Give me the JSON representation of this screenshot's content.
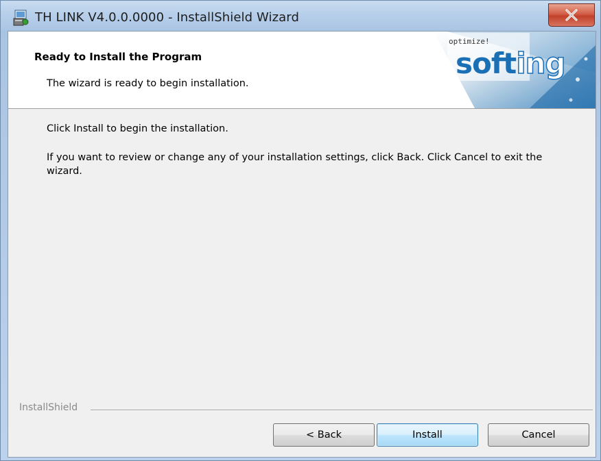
{
  "window": {
    "title": "TH LINK V4.0.0.0000 - InstallShield Wizard",
    "icon": "installer-icon",
    "close_icon": "close-icon"
  },
  "header": {
    "title": "Ready to Install the Program",
    "subtitle": "The wizard is ready to begin installation.",
    "banner_tagline": "optimize!",
    "banner_brand_a": "soft",
    "banner_brand_b": "ing"
  },
  "body": {
    "line1": "Click Install to begin the installation.",
    "line2": "If you want to review or change any of your installation settings, click Back. Click Cancel to exit the wizard."
  },
  "footer": {
    "brand": "InstallShield",
    "back_label": "< Back",
    "install_label": "Install",
    "cancel_label": "Cancel"
  },
  "colors": {
    "brand_blue": "#1b6fb5",
    "default_button_border": "#3c7fb1",
    "close_red": "#c2412a"
  }
}
